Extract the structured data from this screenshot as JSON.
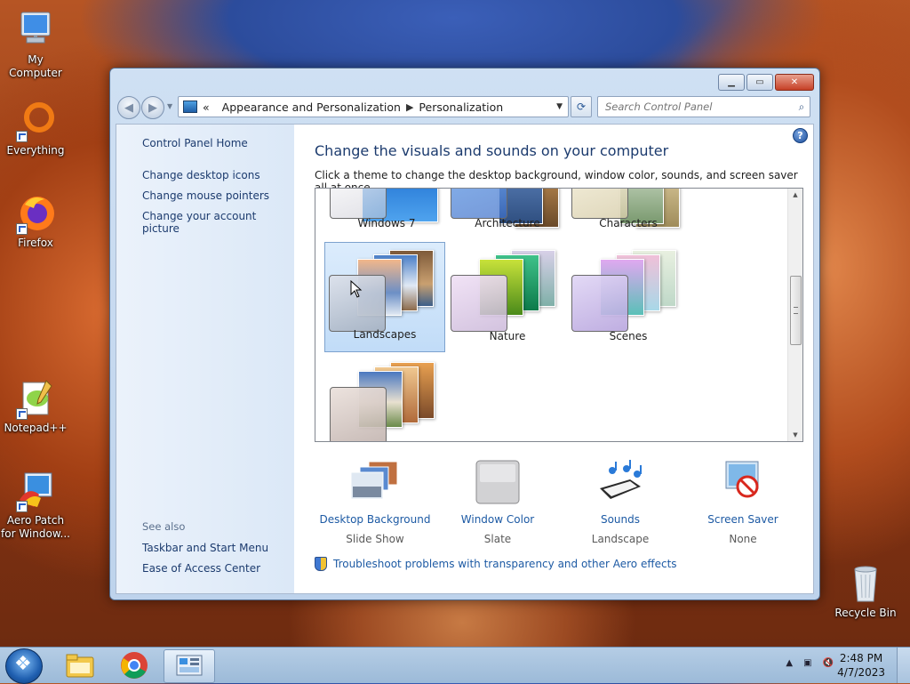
{
  "desktop": {
    "icons": [
      {
        "label": "My Computer",
        "icon": "computer-icon"
      },
      {
        "label": "Everything",
        "icon": "everything-icon"
      },
      {
        "label": "Firefox",
        "icon": "firefox-icon"
      },
      {
        "label": "Notepad++",
        "icon": "notepadpp-icon"
      },
      {
        "label": "Aero Patch for Window...",
        "icon": "aero-patch-icon"
      },
      {
        "label": "Recycle Bin",
        "icon": "recycle-bin-icon"
      }
    ]
  },
  "window": {
    "address": {
      "overflow": "«",
      "crumbs": [
        "Appearance and Personalization",
        "Personalization"
      ]
    },
    "search": {
      "placeholder": "Search Control Panel"
    },
    "left_pane": {
      "home": "Control Panel Home",
      "links": [
        "Change desktop icons",
        "Change mouse pointers",
        "Change your account picture"
      ],
      "see_also_label": "See also",
      "see_also": [
        "Taskbar and Start Menu",
        "Ease of Access Center"
      ]
    },
    "main": {
      "title": "Change the visuals and sounds on your computer",
      "subtitle": "Click a theme to change the desktop background, window color, sounds, and screen saver all at once.",
      "themes": [
        {
          "name": "Windows 7",
          "selected": false
        },
        {
          "name": "Architecture",
          "selected": false
        },
        {
          "name": "Characters",
          "selected": false
        },
        {
          "name": "Landscapes",
          "selected": true
        },
        {
          "name": "Nature",
          "selected": false
        },
        {
          "name": "Scenes",
          "selected": false
        },
        {
          "name": "",
          "selected": false
        }
      ],
      "settings": [
        {
          "label": "Desktop Background",
          "value": "Slide Show",
          "icon": "desktop-background-icon"
        },
        {
          "label": "Window Color",
          "value": "Slate",
          "icon": "window-color-icon"
        },
        {
          "label": "Sounds",
          "value": "Landscape",
          "icon": "sounds-icon"
        },
        {
          "label": "Screen Saver",
          "value": "None",
          "icon": "screen-saver-icon"
        }
      ],
      "troubleshoot": "Troubleshoot problems with transparency and other Aero effects"
    }
  },
  "taskbar": {
    "items": [
      "file-explorer-icon",
      "chrome-icon",
      "control-panel-icon"
    ],
    "clock": {
      "time": "2:48 PM",
      "date": "4/7/2023"
    }
  }
}
